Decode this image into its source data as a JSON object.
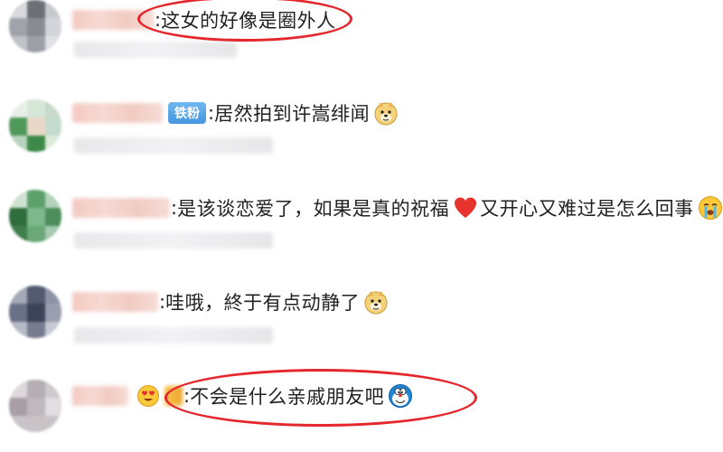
{
  "comments": [
    {
      "separator": ":",
      "text": "这女的好像是圈外人",
      "badge": "",
      "emoji": ""
    },
    {
      "separator": ":",
      "text": "居然拍到许嵩绯闻",
      "badge": "铁粉",
      "emoji": "doge-emoji"
    },
    {
      "separator": ":",
      "text": "是该谈恋爱了，如果是真的祝福",
      "text2": "又开心又难过是怎么回事",
      "badge": "",
      "emoji": "crying-emoji",
      "heart": "heart-emoji"
    },
    {
      "separator": ":",
      "text": "哇哦，終于有点动静了",
      "badge": "",
      "emoji": "doge-emoji"
    },
    {
      "separator": ":",
      "text": "不会是什么亲戚朋友吧",
      "badge": "",
      "emoji": "doraemon-emoji"
    }
  ],
  "colors": {
    "highlight": "#e5262c",
    "badge": "#4596e0",
    "text": "#222222"
  }
}
